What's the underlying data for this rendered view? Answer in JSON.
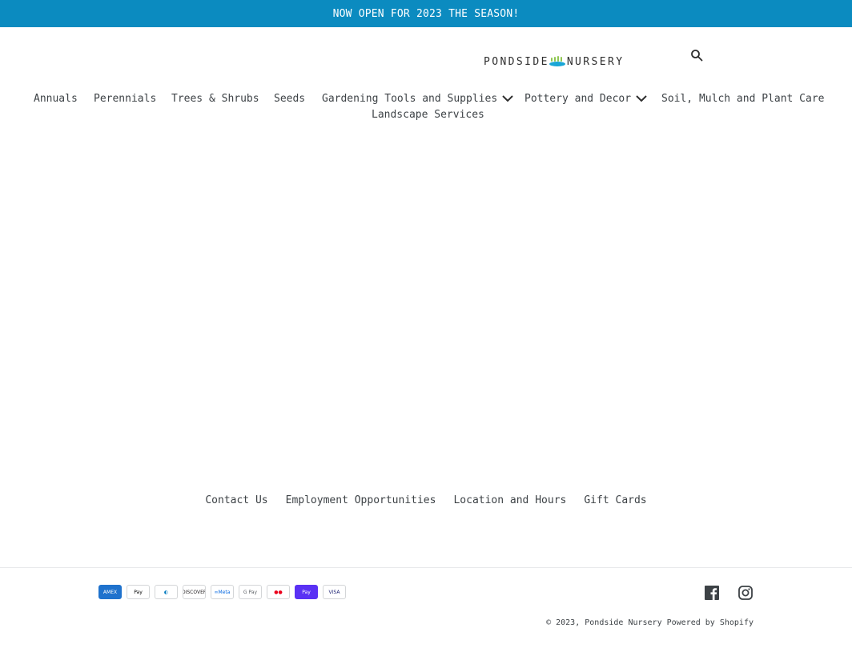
{
  "announcement": {
    "text": "NOW OPEN FOR 2023 THE SEASON!"
  },
  "header": {
    "logo": {
      "left": "PONDSIDE",
      "right": "NURSERY"
    },
    "search_icon": "search-icon"
  },
  "nav": {
    "items": [
      {
        "label": "Annuals"
      },
      {
        "label": "Perennials"
      },
      {
        "label": "Trees & Shrubs"
      },
      {
        "label": "Seeds"
      },
      {
        "label": "Gardening Tools and Supplies",
        "dropdown": true
      },
      {
        "label": "Pottery and Decor",
        "dropdown": true
      },
      {
        "label": "Soil, Mulch and Plant Care"
      },
      {
        "label": "Landscape Services"
      }
    ]
  },
  "footer": {
    "links": [
      "Contact Us",
      "Employment Opportunities",
      "Location and Hours",
      "Gift Cards"
    ],
    "payments": [
      {
        "name": "American Express",
        "label": "AMEX",
        "bg": "#1f72cd",
        "fg": "#ffffff"
      },
      {
        "name": "Apple Pay",
        "label": " Pay",
        "bg": "#ffffff",
        "fg": "#000000"
      },
      {
        "name": "Diners Club",
        "label": "◐",
        "bg": "#ffffff",
        "fg": "#0079be"
      },
      {
        "name": "Discover",
        "label": "DISCOVER",
        "bg": "#ffffff",
        "fg": "#231f20"
      },
      {
        "name": "Meta Pay",
        "label": "∞Meta",
        "bg": "#ffffff",
        "fg": "#0668e1"
      },
      {
        "name": "Google Pay",
        "label": "G Pay",
        "bg": "#ffffff",
        "fg": "#5f6368"
      },
      {
        "name": "Mastercard",
        "label": "●●",
        "bg": "#ffffff",
        "fg": "#eb001b"
      },
      {
        "name": "Shop Pay",
        "label": "Pay",
        "bg": "#5a31f4",
        "fg": "#ffffff"
      },
      {
        "name": "Visa",
        "label": "VISA",
        "bg": "#ffffff",
        "fg": "#1a1f71"
      }
    ],
    "copyright": {
      "prefix": "© 2023,",
      "store": "Pondside Nursery",
      "powered": "Powered by Shopify"
    }
  },
  "colors": {
    "announcement_bg": "#0b8bc0",
    "text": "#3d4246"
  }
}
